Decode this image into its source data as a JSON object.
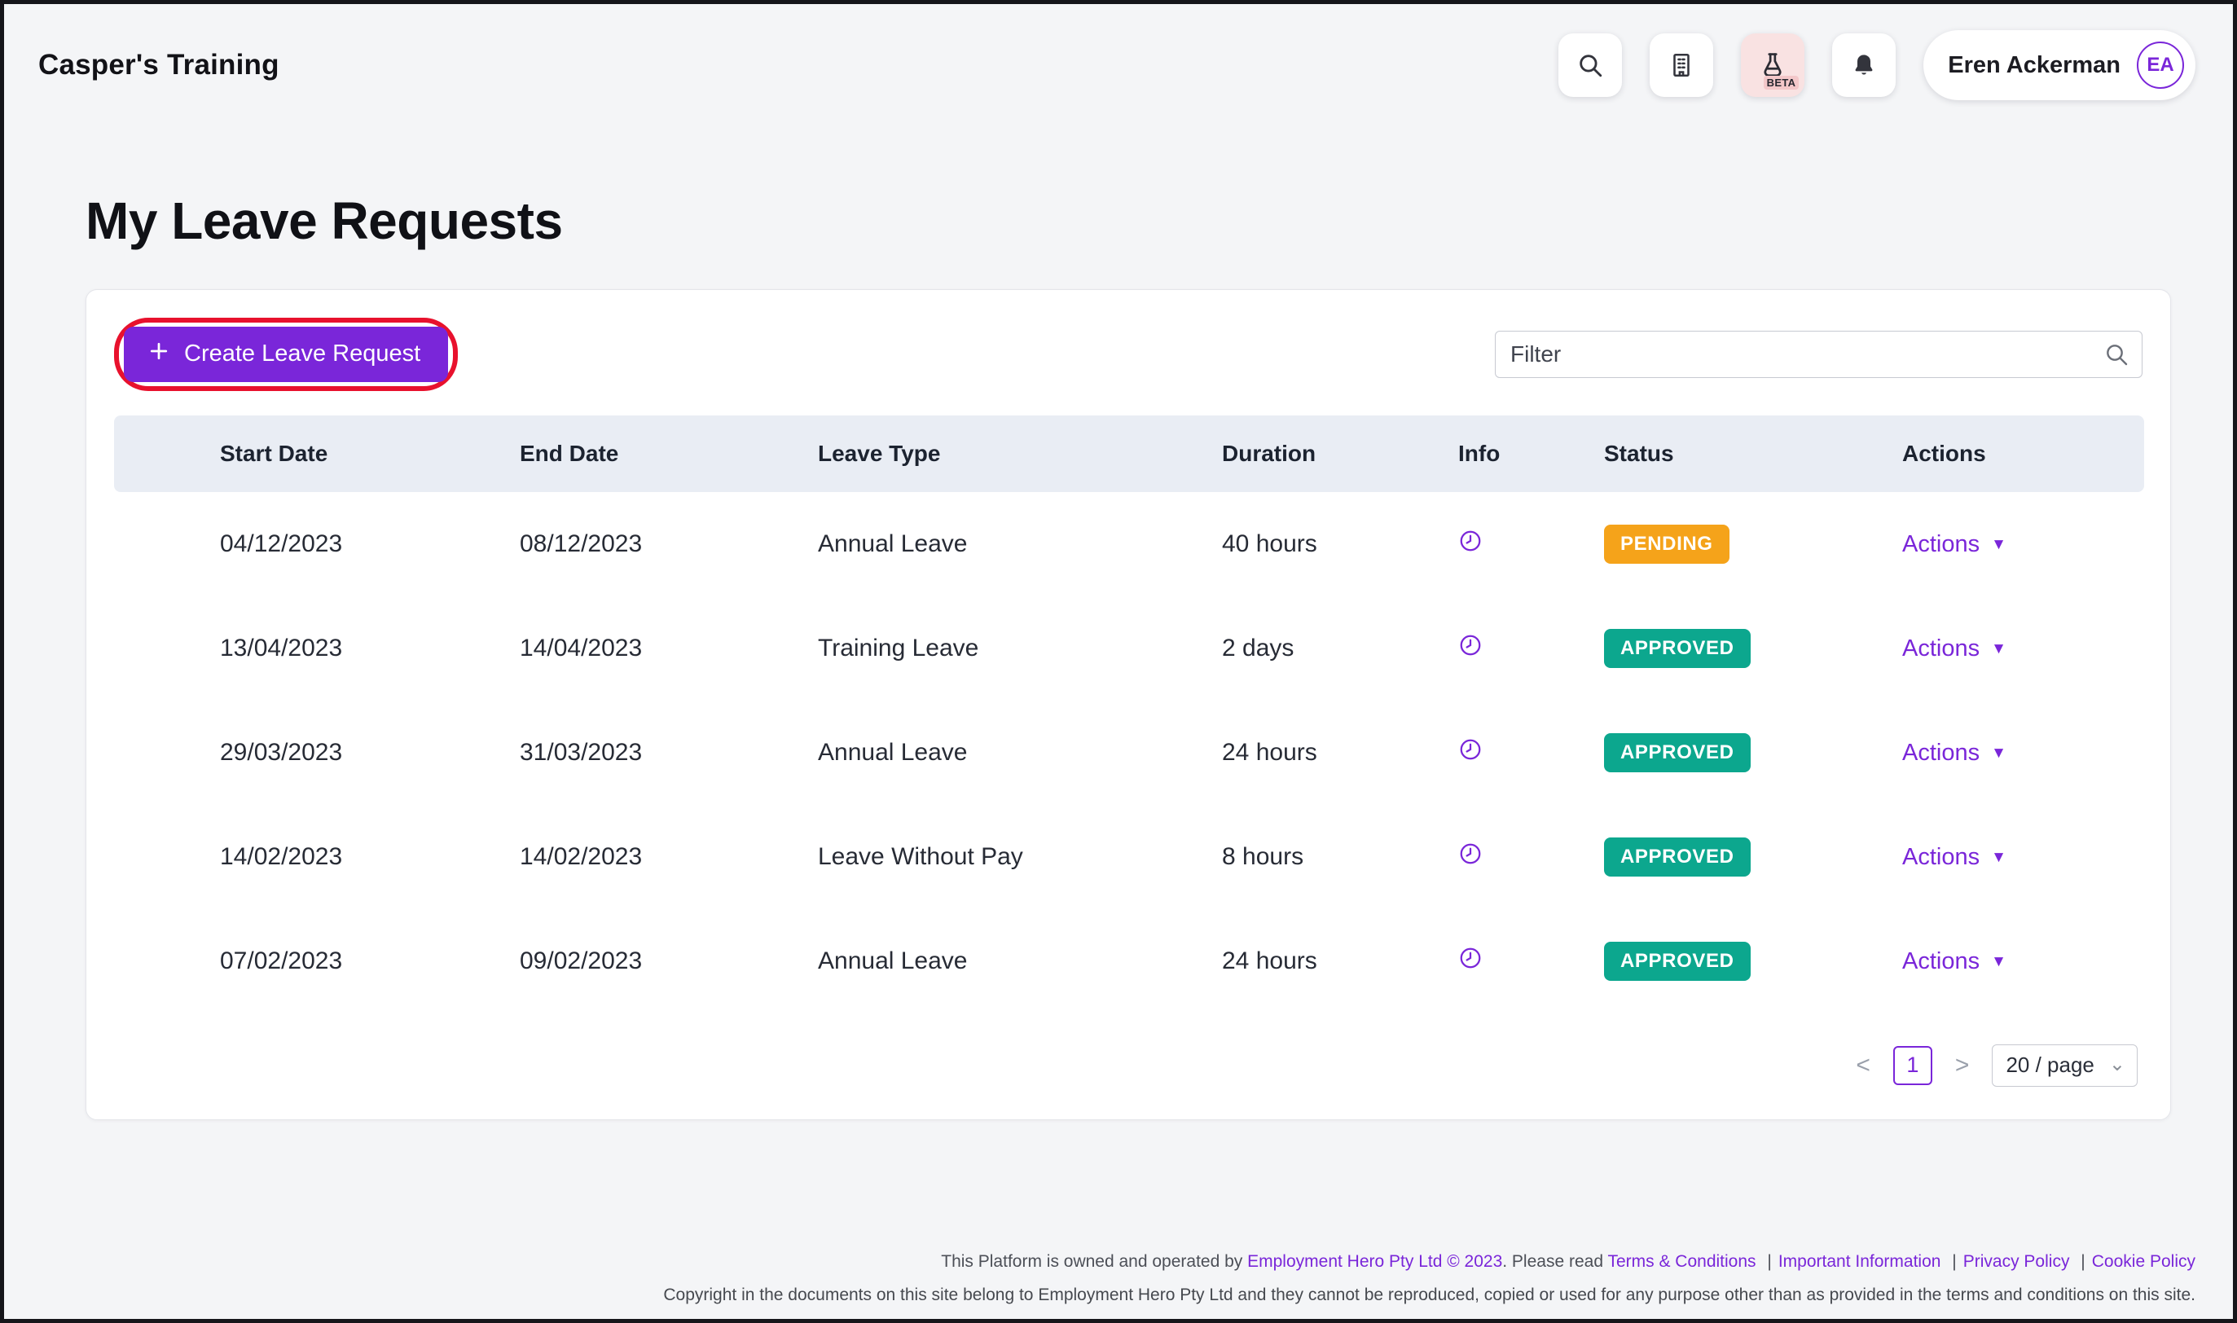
{
  "header": {
    "brand": "Casper's Training",
    "beta_label": "BETA",
    "user": {
      "name": "Eren Ackerman",
      "initials": "EA"
    }
  },
  "page": {
    "title": "My Leave Requests"
  },
  "toolbar": {
    "create_label": "Create Leave Request",
    "filter_placeholder": "Filter"
  },
  "table": {
    "columns": [
      "Start Date",
      "End Date",
      "Leave Type",
      "Duration",
      "Info",
      "Status",
      "Actions"
    ],
    "rows": [
      {
        "start_date": "04/12/2023",
        "end_date": "08/12/2023",
        "leave_type": "Annual Leave",
        "duration": "40 hours",
        "status": "PENDING",
        "status_color": "#F5A31A",
        "actions_label": "Actions"
      },
      {
        "start_date": "13/04/2023",
        "end_date": "14/04/2023",
        "leave_type": "Training Leave",
        "duration": "2 days",
        "status": "APPROVED",
        "status_color": "#0CA78E",
        "actions_label": "Actions"
      },
      {
        "start_date": "29/03/2023",
        "end_date": "31/03/2023",
        "leave_type": "Annual Leave",
        "duration": "24 hours",
        "status": "APPROVED",
        "status_color": "#0CA78E",
        "actions_label": "Actions"
      },
      {
        "start_date": "14/02/2023",
        "end_date": "14/02/2023",
        "leave_type": "Leave Without Pay",
        "duration": "8 hours",
        "status": "APPROVED",
        "status_color": "#0CA78E",
        "actions_label": "Actions"
      },
      {
        "start_date": "07/02/2023",
        "end_date": "09/02/2023",
        "leave_type": "Annual Leave",
        "duration": "24 hours",
        "status": "APPROVED",
        "status_color": "#0CA78E",
        "actions_label": "Actions"
      }
    ]
  },
  "pagination": {
    "prev": "<",
    "page": "1",
    "next": ">",
    "page_size": "20 / page"
  },
  "ui": {
    "caret_down": "▼",
    "select_caret": "⌄"
  },
  "footer": {
    "line1_prefix": "This Platform is owned and operated by ",
    "line1_link": "Employment Hero Pty Ltd © 2023",
    "line1_mid": ". Please read ",
    "links": [
      "Terms & Conditions",
      "Important Information",
      "Privacy Policy",
      "Cookie Policy"
    ],
    "separator": "|",
    "line2": "Copyright in the documents on this site belong to Employment Hero Pty Ltd and they cannot be reproduced, copied or used for any purpose other than as provided in the terms and conditions on this site."
  },
  "colors": {
    "accent": "#7A26D9",
    "pending": "#F5A31A",
    "approved": "#0CA78E",
    "highlight_ring": "#E8112D"
  }
}
